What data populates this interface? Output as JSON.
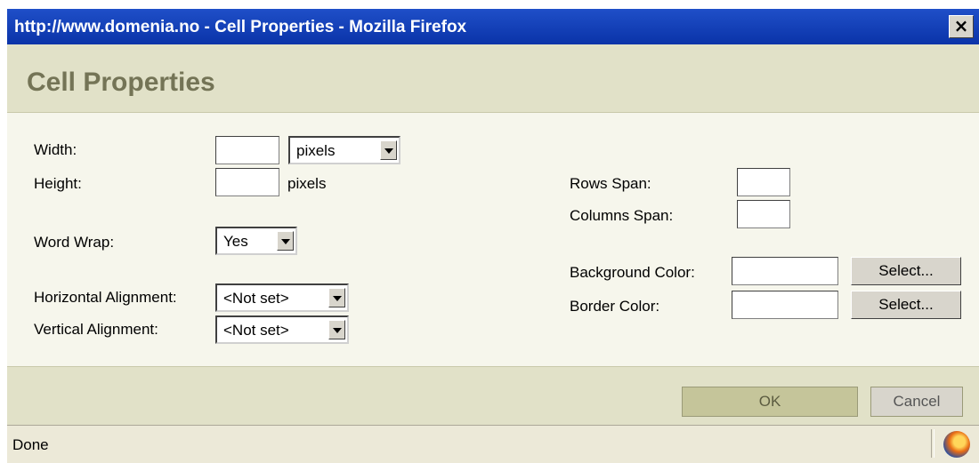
{
  "window": {
    "title": "http://www.domenia.no - Cell Properties - Mozilla Firefox",
    "close_label": "×"
  },
  "dialog": {
    "title": "Cell Properties"
  },
  "form": {
    "width": {
      "label": "Width:",
      "value": "",
      "unit_selected": "pixels"
    },
    "height": {
      "label": "Height:",
      "value": "",
      "unit": "pixels"
    },
    "word_wrap": {
      "label": "Word Wrap:",
      "selected": "Yes"
    },
    "horizontal_alignment": {
      "label": "Horizontal Alignment:",
      "selected": "<Not set>"
    },
    "vertical_alignment": {
      "label": "Vertical Alignment:",
      "selected": "<Not set>"
    },
    "rows_span": {
      "label": "Rows Span:",
      "value": ""
    },
    "columns_span": {
      "label": "Columns Span:",
      "value": ""
    },
    "background_color": {
      "label": "Background Color:",
      "value": "",
      "select_label": "Select..."
    },
    "border_color": {
      "label": "Border Color:",
      "value": "",
      "select_label": "Select..."
    }
  },
  "footer": {
    "ok_label": "OK",
    "cancel_label": "Cancel"
  },
  "status": {
    "text": "Done",
    "icon": "firefox-icon"
  },
  "colors": {
    "titlebar": "#0a33a8",
    "header_bg": "#e1e1c8",
    "content_bg": "#f6f6ec",
    "dialog_title": "#747456"
  }
}
